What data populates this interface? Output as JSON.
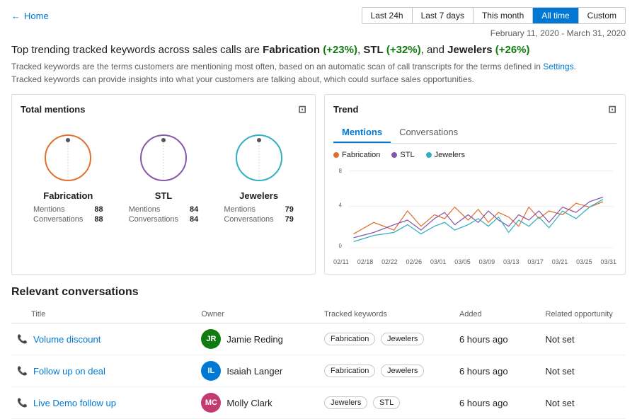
{
  "header": {
    "back_label": "Home",
    "filters": [
      {
        "label": "Last 24h",
        "id": "last24h",
        "active": false
      },
      {
        "label": "Last 7 days",
        "id": "last7days",
        "active": false
      },
      {
        "label": "This month",
        "id": "thismonth",
        "active": false
      },
      {
        "label": "All time",
        "id": "alltime",
        "active": true
      },
      {
        "label": "Custom",
        "id": "custom",
        "active": false
      }
    ]
  },
  "date_range": "February 11, 2020 - March 31, 2020",
  "headline": {
    "prefix": "Top trending tracked keywords across sales calls are ",
    "k1": "Fabrication",
    "k1_change": "(+23%)",
    "separator1": ", ",
    "k2": "STL",
    "k2_change": "(+32%)",
    "separator2": ", and ",
    "k3": "Jewelers",
    "k3_change": "(+26%)"
  },
  "description": {
    "line1": "Tracked keywords are the terms customers are mentioning most often, based on an automatic scan of call transcripts for the terms defined in Settings.",
    "line2": "Tracked keywords can provide insights into what your customers are talking about, which could surface sales opportunities.",
    "settings_label": "Settings"
  },
  "mentions_panel": {
    "title": "Total mentions",
    "keywords": [
      {
        "label": "Fabrication",
        "color": "#e07030",
        "mentions": 88,
        "conversations": 88
      },
      {
        "label": "STL",
        "color": "#8858a8",
        "mentions": 84,
        "conversations": 84
      },
      {
        "label": "Jewelers",
        "color": "#30b0c0",
        "mentions": 79,
        "conversations": 79
      }
    ]
  },
  "trend_panel": {
    "title": "Trend",
    "tabs": [
      "Mentions",
      "Conversations"
    ],
    "active_tab": 0,
    "legend": [
      {
        "label": "Fabrication",
        "color": "#e07030"
      },
      {
        "label": "STL",
        "color": "#8858a8"
      },
      {
        "label": "Jewelers",
        "color": "#30b0c0"
      }
    ],
    "y_labels": [
      "8",
      "4",
      "0"
    ],
    "x_labels": [
      "02/11",
      "02/18",
      "02/22",
      "02/26",
      "03/01",
      "03/05",
      "03/09",
      "03/13",
      "03/17",
      "03/21",
      "03/25",
      "03/31"
    ]
  },
  "conversations": {
    "title": "Relevant conversations",
    "columns": [
      "Title",
      "Owner",
      "Tracked keywords",
      "Added",
      "Related opportunity"
    ],
    "rows": [
      {
        "title": "Volume discount",
        "owner_initials": "JR",
        "owner_name": "Jamie Reding",
        "owner_color": "#107c10",
        "keywords": [
          "Fabrication",
          "Jewelers"
        ],
        "added": "6 hours ago",
        "opportunity": "Not set"
      },
      {
        "title": "Follow up on deal",
        "owner_initials": "IL",
        "owner_name": "Isaiah Langer",
        "owner_color": "#0078d4",
        "keywords": [
          "Fabrication",
          "Jewelers"
        ],
        "added": "6 hours ago",
        "opportunity": "Not set"
      },
      {
        "title": "Live Demo follow up",
        "owner_initials": "MC",
        "owner_name": "Molly Clark",
        "owner_color": "#c23b73",
        "keywords": [
          "Jewelers",
          "STL"
        ],
        "added": "6 hours ago",
        "opportunity": "Not set"
      }
    ]
  }
}
